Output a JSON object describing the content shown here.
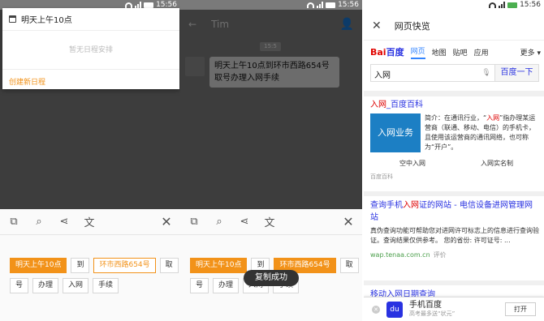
{
  "status": {
    "time": "15:56"
  },
  "calendar_popup": {
    "title": "明天上午10点",
    "empty_text": "暂无日程安排",
    "create_label": "创建新日程"
  },
  "chat": {
    "contact": "Tim",
    "time_label": "15:5",
    "message": "明天上午10点到环市西路654号取号办理入网手续"
  },
  "sheet": {
    "tools": [
      "copy-icon",
      "search-icon",
      "share-icon",
      "translate-icon",
      "close-icon"
    ],
    "chips": [
      "明天上午10点",
      "到",
      "环市西路654号",
      "取",
      "号",
      "办理",
      "入网",
      "手续"
    ]
  },
  "toast": "复制成功",
  "browser": {
    "title": "网页快览",
    "logo_a": "Bai",
    "logo_b": "百度",
    "nav": [
      "网页",
      "地图",
      "贴吧",
      "应用",
      "更多"
    ],
    "query": "入网",
    "search_button": "百度一下",
    "result1": {
      "title_hl": "入网",
      "title_rest": "_百度百科",
      "image_text": "入网业务",
      "desc_pre": "简介：在通讯行业，“",
      "desc_hl": "入网",
      "desc_post": "”指办理某运营商（联通、移动、电信）的手机卡，且使用该运营商的通讯网络，也可称为“开户”。",
      "links": [
        "空中入网",
        "入网实名制"
      ],
      "source": "百度百科"
    },
    "result2": {
      "title_pre": "查询手机",
      "title_hl": "入网",
      "title_post": "证的网站 - 电信设备进网管理网站",
      "desc": "真伪查询功能可帮助您对进网许可标志上的信息进行查询验证。查询结果仅供参考。 您的省份: 许可证号: ...",
      "source": "wap.tenaa.com.cn",
      "source_note": "评价"
    },
    "result3_clip": "移动入网日期查询",
    "banner": {
      "app": "手机百度",
      "sub": "高考最多送“状元”",
      "open": "打开"
    }
  },
  "colors": {
    "accent": "#f29219",
    "baidu_blue": "#2932e1",
    "baidu_red": "#e10602"
  }
}
